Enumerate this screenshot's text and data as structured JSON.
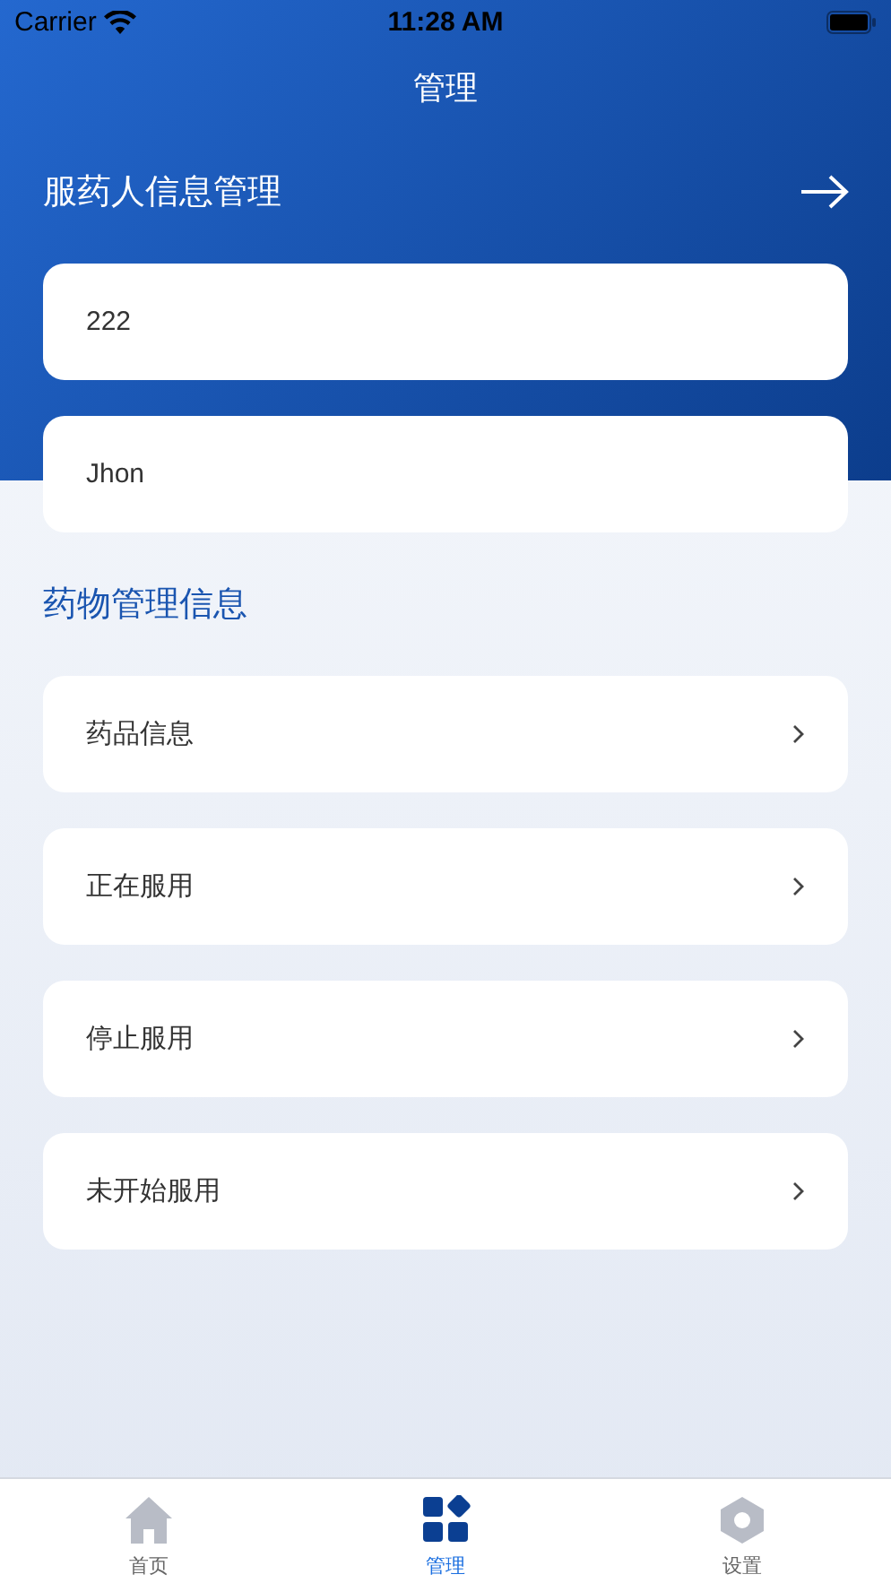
{
  "status_bar": {
    "carrier": "Carrier",
    "time": "11:28 AM"
  },
  "nav": {
    "title": "管理"
  },
  "patient_section": {
    "title": "服药人信息管理",
    "fields": [
      {
        "value": "222"
      },
      {
        "value": "Jhon"
      }
    ]
  },
  "medication_section": {
    "title": "药物管理信息",
    "items": [
      {
        "label": "药品信息"
      },
      {
        "label": "正在服用"
      },
      {
        "label": "停止服用"
      },
      {
        "label": "未开始服用"
      }
    ]
  },
  "tab_bar": [
    {
      "label": "首页",
      "kind": "home",
      "selected": false
    },
    {
      "label": "管理",
      "kind": "manage",
      "selected": true
    },
    {
      "label": "设置",
      "kind": "settings",
      "selected": false
    }
  ]
}
